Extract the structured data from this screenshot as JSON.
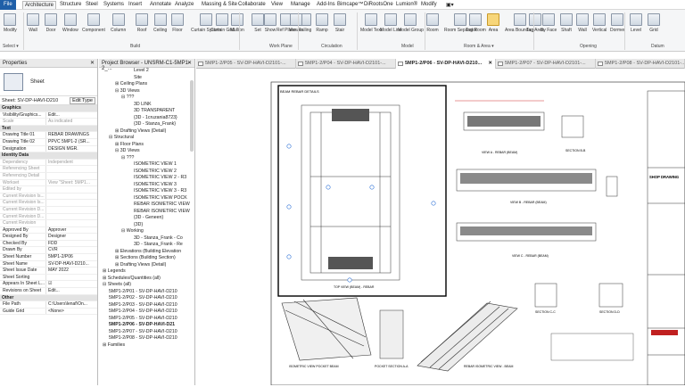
{
  "menubar": {
    "items": [
      "File",
      "Architecture",
      "Structure",
      "Steel",
      "Systems",
      "Insert",
      "Annotate",
      "Analyze",
      "Massing & Site",
      "Collaborate",
      "View",
      "Manage",
      "Add-Ins",
      "Bimcape™",
      "DiRootsOne",
      "Lumion®",
      "Modify",
      "▣▾"
    ]
  },
  "ribbon": {
    "buttons": [
      "Modify",
      "Wall",
      "Door",
      "Window",
      "Component",
      "Column",
      "Roof",
      "Ceiling",
      "Floor",
      "Curtain System",
      "Curtain Grid",
      "Mullion",
      "Railing",
      "Ramp",
      "Stair",
      "Model Text",
      "Model Line",
      "Model Group",
      "Room",
      "Room Separator",
      "Tag Room",
      "Area",
      "Area Boundary",
      "Tag Area",
      "By Face",
      "Shaft",
      "Wall",
      "Vertical",
      "Dormer",
      "Level",
      "Grid"
    ],
    "panels": [
      "Select ▾",
      "Build",
      "Work Plane",
      "Circulation",
      "Model",
      "Room & Area ▾",
      "Opening",
      "Datum"
    ],
    "set_labels": [
      "Set",
      "Show",
      "Ref Plane",
      "Viewer"
    ]
  },
  "properties": {
    "title": "Properties",
    "type_name": "Sheet",
    "combo_value": "Sheet: SV-DP-HAVI-D210",
    "edit_type": "Edit Type",
    "rows": [
      {
        "k": "Graphics",
        "v": "",
        "grp": true
      },
      {
        "k": "Visibility/Graphics...",
        "v": "Edit..."
      },
      {
        "k": "Scale",
        "v": "As indicated",
        "grey": true
      },
      {
        "k": "Text",
        "v": "",
        "grp": true
      },
      {
        "k": "Drawing Title 01",
        "v": "REBAR DRAWINGS"
      },
      {
        "k": "Drawing Title 02",
        "v": "PPVC 5MP1-2 (SR..."
      },
      {
        "k": "Designation",
        "v": "DESIGN MGR."
      },
      {
        "k": "Identity Data",
        "v": "",
        "grp": true
      },
      {
        "k": "Dependency",
        "v": "Independent",
        "grey": true
      },
      {
        "k": "Referencing Sheet",
        "v": "",
        "grey": true
      },
      {
        "k": "Referencing Detail",
        "v": "",
        "grey": true
      },
      {
        "k": "Workset",
        "v": "View \"Sheet: 5MP1...",
        "grey": true
      },
      {
        "k": "Edited by",
        "v": "",
        "grey": true
      },
      {
        "k": "Current Revision Is...",
        "v": "",
        "grey": true
      },
      {
        "k": "Current Revision Is...",
        "v": "",
        "grey": true
      },
      {
        "k": "Current Revision D...",
        "v": "",
        "grey": true
      },
      {
        "k": "Current Revision D...",
        "v": "",
        "grey": true
      },
      {
        "k": "Current Revision",
        "v": "",
        "grey": true
      },
      {
        "k": "Approved By",
        "v": "Approver"
      },
      {
        "k": "Designed By",
        "v": "Designer"
      },
      {
        "k": "Checked By",
        "v": "FDD"
      },
      {
        "k": "Drawn By",
        "v": "CVR"
      },
      {
        "k": "Sheet Number",
        "v": "5MP1-2/P06"
      },
      {
        "k": "Sheet Name",
        "v": "SV-DP-HAVI-D210..."
      },
      {
        "k": "Sheet Issue Date",
        "v": "MAY 2022"
      },
      {
        "k": "Sheet Sorting",
        "v": ""
      },
      {
        "k": "Appears In Sheet L...",
        "v": "☑"
      },
      {
        "k": "Revisions on Sheet",
        "v": "Edit..."
      },
      {
        "k": "Other",
        "v": "",
        "grp": true
      },
      {
        "k": "File Path",
        "v": "C:\\Users\\lenaf\\On..."
      },
      {
        "k": "Guide Grid",
        "v": "<None>"
      }
    ]
  },
  "browser": {
    "title": "Project Browser - UNSRM-C1-5MP1-2_...",
    "nodes": [
      {
        "t": "Level 2",
        "d": 5
      },
      {
        "t": "Site",
        "d": 5
      },
      {
        "t": "⊞ Ceiling Plans",
        "d": 2
      },
      {
        "t": "⊟ 3D Views",
        "d": 2
      },
      {
        "t": "⊟ ???",
        "d": 3
      },
      {
        "t": "3D LINK",
        "d": 5
      },
      {
        "t": "3D TRANSPARENT",
        "d": 5
      },
      {
        "t": "{3D - 1cruzania8723}",
        "d": 5
      },
      {
        "t": "{3D - Stanza_Frank}",
        "d": 5
      },
      {
        "t": "⊞ Drafting Views (Detail)",
        "d": 2
      },
      {
        "t": "⊟ Structural",
        "d": 1
      },
      {
        "t": "⊞ Floor Plans",
        "d": 2
      },
      {
        "t": "⊟ 3D Views",
        "d": 2
      },
      {
        "t": "⊟ ???",
        "d": 3
      },
      {
        "t": "ISOMETRIC VIEW 1",
        "d": 5
      },
      {
        "t": "ISOMETRIC VIEW 2",
        "d": 5
      },
      {
        "t": "ISOMETRIC VIEW 2 - R3",
        "d": 5
      },
      {
        "t": "ISOMETRIC VIEW 3",
        "d": 5
      },
      {
        "t": "ISOMETRIC VIEW 3 - R3",
        "d": 5
      },
      {
        "t": "ISOMETRIC VIEW POCK",
        "d": 5
      },
      {
        "t": "REBAR ISOMETRIC VIEW",
        "d": 5
      },
      {
        "t": "REBAR ISOMETRIC VIEW",
        "d": 5
      },
      {
        "t": "{3D - Geneen}",
        "d": 5
      },
      {
        "t": "{3D}",
        "d": 5
      },
      {
        "t": "⊟ Working",
        "d": 3
      },
      {
        "t": "3D - Stanza_Frank - Co",
        "d": 5
      },
      {
        "t": "3D - Stanza_Frank - Re",
        "d": 5
      },
      {
        "t": "⊞ Elevations (Building Elevation",
        "d": 2
      },
      {
        "t": "⊞ Sections (Building Section)",
        "d": 2
      },
      {
        "t": "⊞ Drafting Views (Detail)",
        "d": 2
      },
      {
        "t": "⊞ Legends",
        "d": 0
      },
      {
        "t": "⊞ Schedules/Quantities (all)",
        "d": 0
      },
      {
        "t": "⊟ Sheets (all)",
        "d": 0
      },
      {
        "t": "5MP1-2/P01 - SV-DP-HAVI-D210",
        "d": 1
      },
      {
        "t": "5MP1-2/P02 - SV-DP-HAVI-D210",
        "d": 1
      },
      {
        "t": "5MP1-2/P03 - SV-DP-HAVI-D210",
        "d": 1
      },
      {
        "t": "5MP1-2/P04 - SV-DP-HAVI-D210",
        "d": 1
      },
      {
        "t": "5MP1-2/P05 - SV-DP-HAVI-D210",
        "d": 1
      },
      {
        "t": "5MP1-2/P06 - SV-DP-HAVI-D21",
        "d": 1,
        "bold": true
      },
      {
        "t": "5MP1-2/P07 - SV-DP-HAVI-D210",
        "d": 1
      },
      {
        "t": "5MP1-2/P08 - SV-DP-HAVI-D210",
        "d": 1
      },
      {
        "t": "⊞ Families",
        "d": 0
      }
    ]
  },
  "tabs": [
    {
      "label": "5MP1-2/P05 - SV-DP-HAVI-D2101-...",
      "on": false
    },
    {
      "label": "5MP1-2/P04 - SV-DP-HAVI-D2101-...",
      "on": false
    },
    {
      "label": "5MP1-2/P06 - SV-DP-HAVI-D210...",
      "on": true
    },
    {
      "label": "5MP1-2/P07 - SV-DP-HAVI-D2101-...",
      "on": false
    },
    {
      "label": "5MP1-2/P08 - SV-DP-HAVI-D2101-...",
      "on": false
    }
  ],
  "drawing": {
    "detail_title": "BEAM REBAR DETAILS",
    "plan_caption": "TOP VIEW (BEAM) - REBAR",
    "view_a": "VIEW A - REBAR (BEAM)",
    "section_b": "SECTION B-B",
    "view_b": "VIEW B - REBAR (BEAM)",
    "view_c": "VIEW C - REBAR (BEAM)",
    "section_cc": "SECTION C-C",
    "section_dd": "SECTION D-D",
    "iso_pocket": "ISOMETRIC VIEW POCKET BEAM",
    "pocket_section": "POCKET SECTION A-A",
    "rebar_iso": "REBAR ISOMETRIC VIEW - BEAM",
    "shop_drawing": "SHOP DRAWING"
  },
  "colors": {
    "accent": "#1f5fa8",
    "blue_marker": "#2a6fd6",
    "red_line": "#d03030",
    "titleblock_red": "#c02020"
  }
}
